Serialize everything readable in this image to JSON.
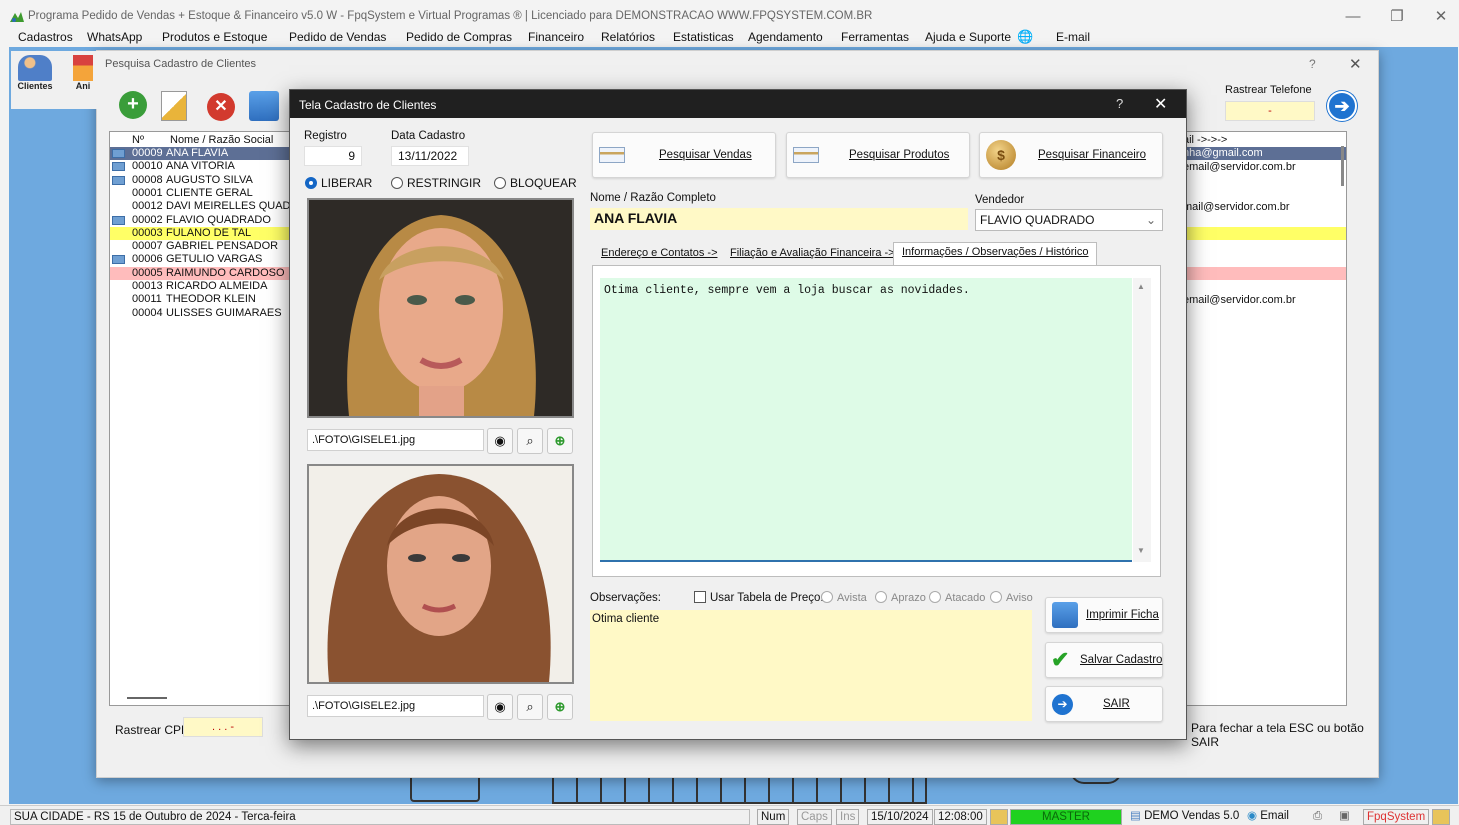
{
  "app": {
    "title": "Programa Pedido de Vendas + Estoque & Financeiro v5.0 W - FpqSystem e Virtual Programas ® | Licenciado para  DEMONSTRACAO WWW.FPQSYSTEM.COM.BR",
    "menu": [
      "Cadastros",
      "WhatsApp",
      "Produtos e Estoque",
      "Pedido de Vendas",
      "Pedido de Compras",
      "Financeiro",
      "Relatórios",
      "Estatisticas",
      "Agendamento",
      "Ferramentas",
      "Ajuda e Suporte",
      "E-mail"
    ],
    "side_tools": [
      "Clientes",
      "Ani"
    ]
  },
  "search_window": {
    "title": "Pesquisa Cadastro de Clientes",
    "help": "?",
    "list_headers": {
      "num": "Nº",
      "name": "Nome / Razão Social"
    },
    "rows": [
      {
        "num": "00009",
        "name": "ANA FLAVIA",
        "style": "selected",
        "icon": true
      },
      {
        "num": "00010",
        "name": "ANA VITORIA",
        "style": "",
        "icon": true
      },
      {
        "num": "00008",
        "name": "AUGUSTO SILVA",
        "style": "",
        "icon": true
      },
      {
        "num": "00001",
        "name": "CLIENTE GERAL",
        "style": "",
        "icon": false
      },
      {
        "num": "00012",
        "name": "DAVI MEIRELLES QUADR",
        "style": "",
        "icon": false
      },
      {
        "num": "00002",
        "name": "FLAVIO QUADRADO",
        "style": "",
        "icon": true
      },
      {
        "num": "00003",
        "name": "FULANO DE TAL",
        "style": "yellow",
        "icon": false
      },
      {
        "num": "00007",
        "name": "GABRIEL PENSADOR",
        "style": "",
        "icon": false
      },
      {
        "num": "00006",
        "name": "GETULIO VARGAS",
        "style": "",
        "icon": true
      },
      {
        "num": "00005",
        "name": "RAIMUNDO CARDOSO",
        "style": "pink",
        "icon": false
      },
      {
        "num": "00013",
        "name": "RICARDO ALMEIDA",
        "style": "",
        "icon": false
      },
      {
        "num": "00011",
        "name": "THEODOR KLEIN",
        "style": "",
        "icon": false
      },
      {
        "num": "00004",
        "name": "ULISSES GUIMARAES",
        "style": "",
        "icon": false
      }
    ],
    "right_rows": [
      "ail ->->->",
      "nha@gmail.com",
      "email@servidor.com.br",
      "",
      "",
      "mail@servidor.com.br",
      "",
      "",
      "",
      "",
      "",
      "",
      "email@servidor.com.br"
    ],
    "rastrear_cpf_label": "Rastrear CPF",
    "rastrear_cpf_value": ". . . -",
    "rastrear_telefone_label": "Rastrear Telefone",
    "rastrear_telefone_value": "-",
    "hint": "Para fechar a tela ESC ou botão SAIR"
  },
  "dialog": {
    "title": "Tela Cadastro de Clientes",
    "help": "?",
    "registro_label": "Registro",
    "registro_value": "9",
    "data_label": "Data Cadastro",
    "data_value": "13/11/2022",
    "status_options": [
      "LIBERAR",
      "RESTRINGIR",
      "BLOQUEAR"
    ],
    "status_selected": "LIBERAR",
    "photo1_path": ".\\FOTO\\GISELE1.jpg",
    "photo2_path": ".\\FOTO\\GISELE2.jpg",
    "btn_vendas": "Pesquisar Vendas",
    "btn_produtos": "Pesquisar Produtos",
    "btn_financeiro": "Pesquisar  Financeiro",
    "nome_label": "Nome / Razão Completo",
    "nome_value": "ANA FLAVIA",
    "vendedor_label": "Vendedor",
    "vendedor_value": "FLAVIO QUADRADO",
    "tabs": [
      "Endereço e Contatos ->",
      "Filiação e Avaliação Financeira ->",
      "Informações / Observações / Histórico"
    ],
    "active_tab": 2,
    "info_text": "Otima cliente, sempre vem a loja buscar as novidades.",
    "obs_label": "Observações:",
    "usar_tabela_label": "Usar Tabela de Preço:",
    "price_options": [
      "Avista",
      "Aprazo",
      "Atacado",
      "Aviso"
    ],
    "obs_value": "Otima cliente",
    "btn_imprimir": "Imprimir Ficha",
    "btn_salvar": "Salvar Cadastro",
    "btn_sair": "SAIR"
  },
  "statusbar": {
    "city": "SUA CIDADE - RS 15 de Outubro de 2024 - Terca-feira",
    "num": "Num",
    "caps": "Caps",
    "ins": "Ins",
    "date": "15/10/2024",
    "time": "12:08:00",
    "user": "MASTER",
    "version": "DEMO Vendas 5.0",
    "email": "Email",
    "brand": "FpqSystem"
  },
  "colors": {
    "desktop": "#6ea9df",
    "selected_row": "#5d6f95",
    "yellow_row": "#ffff66",
    "pink_row": "#ffbcbc",
    "field_yellow": "#fff9c6",
    "memo_green": "#defbe7",
    "status_green": "#1fd11f"
  }
}
